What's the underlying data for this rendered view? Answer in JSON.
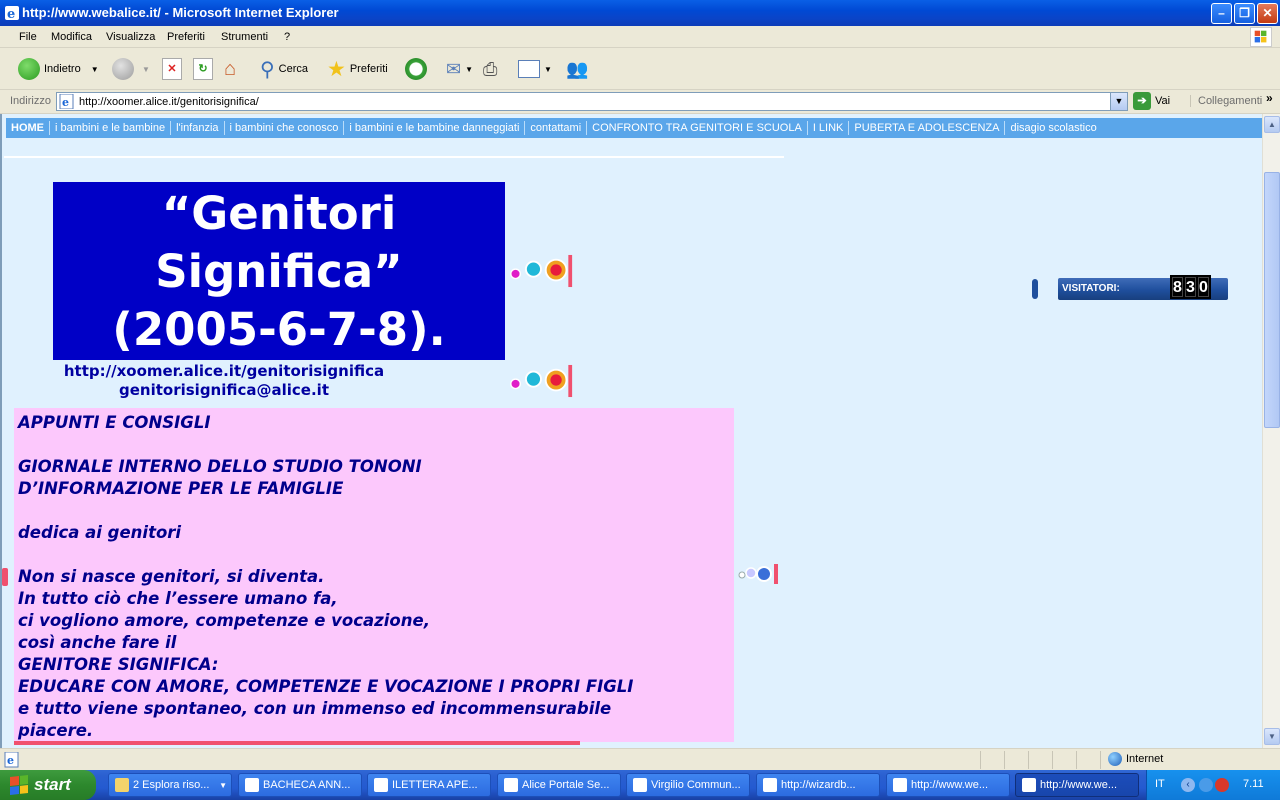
{
  "window": {
    "title": "http://www.webalice.it/ - Microsoft Internet Explorer"
  },
  "menu": [
    "File",
    "Modifica",
    "Visualizza",
    "Preferiti",
    "Strumenti",
    "?"
  ],
  "toolbar": {
    "back_label": "Indietro",
    "search_label": "Cerca",
    "favorites_label": "Preferiti"
  },
  "address": {
    "label": "Indirizzo",
    "url": "http://xoomer.alice.it/genitorisignifica/",
    "go_label": "Vai",
    "links_label": "Collegamenti"
  },
  "nav": {
    "items": [
      "HOME",
      "i bambini e le bambine",
      "l'infanzia",
      "i bambini che conosco",
      "i bambini e le bambine danneggiati",
      "contattami",
      "CONFRONTO TRA GENITORI E SCUOLA",
      "I LINK",
      "PUBERTA E ADOLESCENZA",
      "disagio scolastico"
    ]
  },
  "page": {
    "title_lines": [
      "“Genitori",
      "Significa”",
      "(2005-6-7-8)."
    ],
    "site_url": "http://xoomer.alice.it/genitorisignifica",
    "email": "genitorisignifica@alice.it",
    "body_lines": [
      "APPUNTI E CONSIGLI",
      "",
      "GIORNALE INTERNO DELLO STUDIO TONONI",
      "D’INFORMAZIONE PER LE FAMIGLIE",
      "",
      "dedica ai genitori",
      "",
      "Non si nasce genitori, si diventa.",
      "In tutto ciò che l’essere umano fa,",
      "ci vogliono amore, competenze e vocazione,",
      "così anche fare il",
      "GENITORE SIGNIFICA:",
      "EDUCARE CON AMORE, COMPETENZE E VOCAZIONE I PROPRI FIGLI",
      "e tutto viene spontaneo, con un immenso ed incommensurabile",
      "piacere."
    ]
  },
  "counter": {
    "label": "VISITATORI:",
    "digits": [
      "8",
      "3",
      "0"
    ]
  },
  "status": {
    "zone": "Internet"
  },
  "taskbar": {
    "start_label": "start",
    "tasks": [
      "2 Esplora riso...",
      "BACHECA ANN...",
      "ILETTERA APE...",
      "Alice Portale Se...",
      "Virgilio Commun...",
      "http://wizardb...",
      "http://www.we...",
      "http://www.we..."
    ],
    "lang": "IT",
    "clock": "7.11"
  }
}
